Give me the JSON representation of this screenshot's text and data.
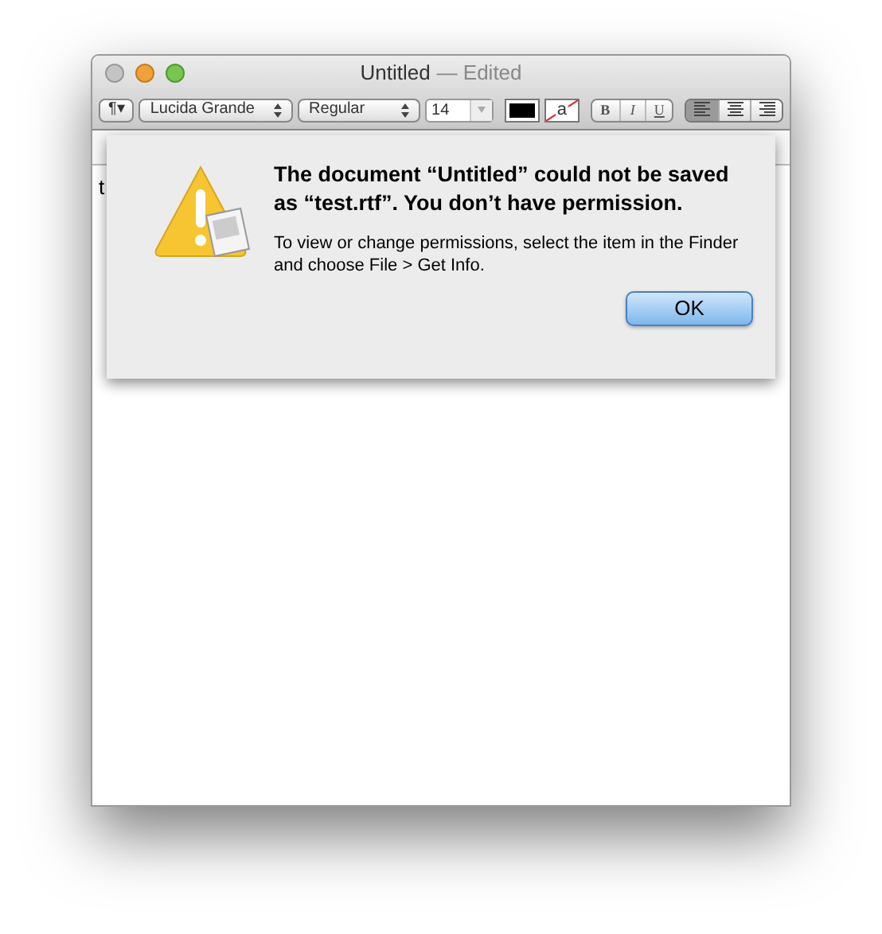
{
  "window": {
    "title": "Untitled",
    "title_suffix": "— Edited"
  },
  "toolbar": {
    "paragraph_button": "¶▾",
    "font_family": "Lucida Grande",
    "font_style": "Regular",
    "font_size": "14",
    "highlight_label": "a",
    "style_buttons": [
      {
        "label": "B",
        "kind": "bold"
      },
      {
        "label": "I",
        "kind": "italic"
      },
      {
        "label": "U",
        "kind": "underline"
      }
    ],
    "alignment": [
      {
        "kind": "left",
        "selected": true
      },
      {
        "kind": "center",
        "selected": false
      },
      {
        "kind": "right",
        "selected": false
      }
    ]
  },
  "document": {
    "text": "t"
  },
  "alert": {
    "message": "The document “Untitled” could not be saved as “test.rtf”. You don’t have permission.",
    "info": "To view or change permissions, select the item in the Finder and choose File > Get Info.",
    "button": "OK"
  }
}
